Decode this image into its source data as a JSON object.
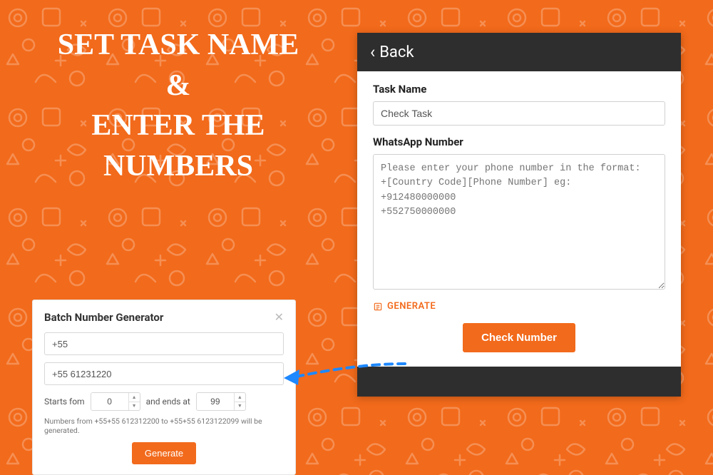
{
  "heading": "SET TASK NAME\n&\nENTER THE\nNUMBERS",
  "app": {
    "back_label": "Back",
    "task_name_label": "Task Name",
    "task_name_value": "Check Task",
    "whatsapp_label": "WhatsApp Number",
    "whatsapp_placeholder": "Please enter your phone number in the format:\n+[Country Code][Phone Number] eg:\n+912480000000\n+552750000000",
    "generate_link": "GENERATE",
    "check_button": "Check Number"
  },
  "modal": {
    "title": "Batch Number Generator",
    "prefix_value": "+55",
    "base_value": "+55 61231220",
    "starts_label": "Starts fom",
    "starts_value": "0",
    "ends_label": "and ends at",
    "ends_value": "99",
    "hint": "Numbers from +55+55 612312200 to +55+55 6123122099 will be generated.",
    "generate_button": "Generate"
  }
}
